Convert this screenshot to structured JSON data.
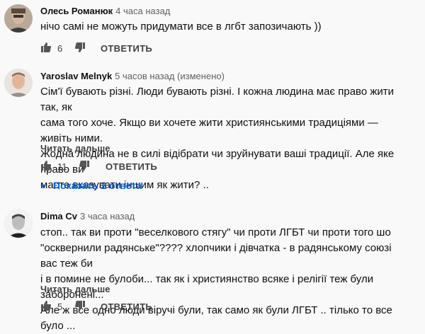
{
  "comments": [
    {
      "author": "Олесь Романюк",
      "meta": "4 часа назад",
      "lines": [
        "нічо самі не можуть придумати все в лгбт запозичають ))"
      ],
      "likes": "6",
      "reply_label": "ОТВЕТИТЬ"
    },
    {
      "author": "Yaroslav Melnyk",
      "meta": "5 часов назад (изменено)",
      "lines": [
        "Сім'ї бувають різні. Люди бувають різні. І кожна людина має право жити так, як",
        "сама того хоче. Якщо ви хочете жити християнськими традиціями — живіть ними.",
        "Жодна людина не в силі відібрати чи зруйнувати ваші традиції. Але яке право ви",
        "маєте вказувати іншим як жити? .."
      ],
      "read_more": "Читать дальше",
      "likes": "11",
      "reply_label": "ОТВЕТИТЬ",
      "show_replies": "Показать 2 ответа"
    },
    {
      "author": "Dima Cv",
      "meta": "3 часа назад",
      "lines": [
        "стоп.. так ви проти \"веселкового стягу\" чи проти ЛГБТ  чи проти того  шо",
        "\"осквернили радянське\"???? хлопчики і дівчатка - в радянському союзі вас теж би",
        "і в помине не булоби... так як і християнство всяке і релігії теж були заборонені...",
        "Але ж все одно люди віручі були, так само як були ЛГБТ .. тілько то все було ..."
      ],
      "read_more": "Читать дальше",
      "likes": "5",
      "reply_label": "ОТВЕТИТЬ"
    }
  ],
  "colors": {
    "accent": "#065fd4",
    "text": "#0f0f0f",
    "meta": "#606060",
    "background": "#f9f9f9"
  }
}
